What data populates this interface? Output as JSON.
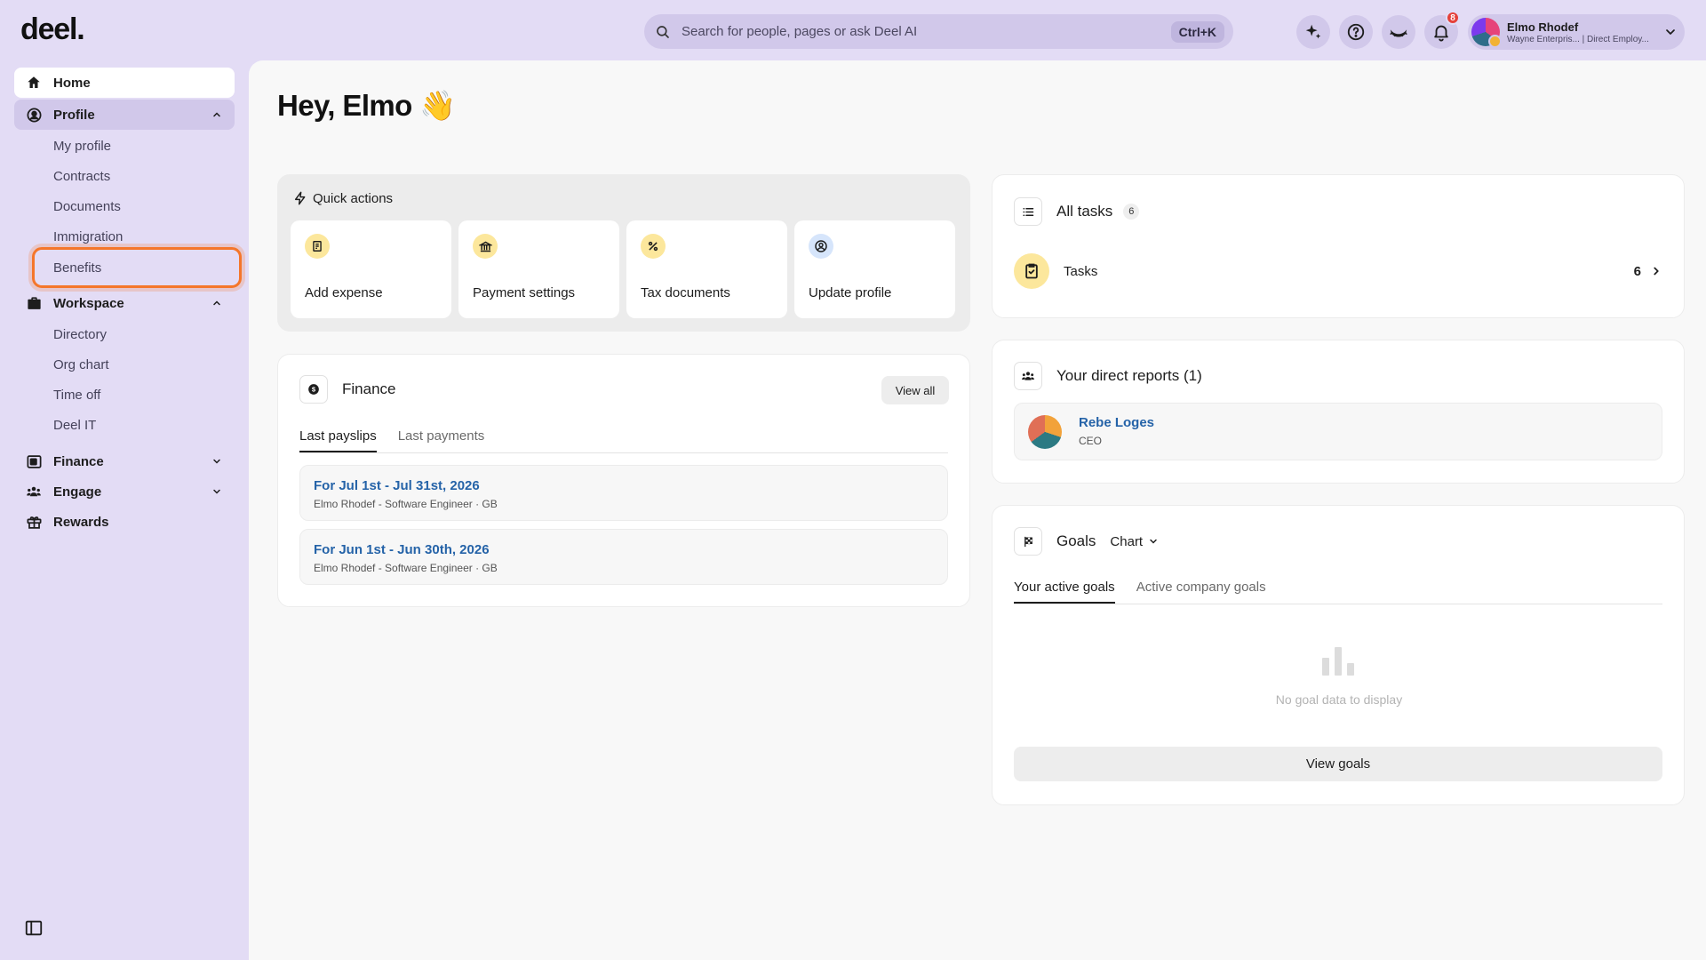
{
  "brand": {
    "logo_text": "deel."
  },
  "search": {
    "placeholder": "Search for people, pages or ask Deel AI",
    "shortcut": "Ctrl+K"
  },
  "topbar": {
    "notification_count": "8"
  },
  "user": {
    "name": "Elmo Rhodef",
    "subtitle": "Wayne Enterpris... | Direct Employ..."
  },
  "sidebar": {
    "home": "Home",
    "profile": "Profile",
    "profile_items": [
      "My profile",
      "Contracts",
      "Documents",
      "Immigration",
      "Benefits"
    ],
    "workspace": "Workspace",
    "workspace_items": [
      "Directory",
      "Org chart",
      "Time off",
      "Deel IT"
    ],
    "finance": "Finance",
    "engage": "Engage",
    "rewards": "Rewards"
  },
  "main": {
    "greeting": "Hey, Elmo 👋",
    "quick_actions": {
      "title": "Quick actions",
      "items": [
        "Add expense",
        "Payment settings",
        "Tax documents",
        "Update profile"
      ]
    },
    "finance": {
      "title": "Finance",
      "view_all": "View all",
      "tabs": [
        "Last payslips",
        "Last payments"
      ],
      "payslips": [
        {
          "title": "For Jul 1st - Jul 31st, 2026",
          "meta": "Elmo Rhodef - Software Engineer · GB"
        },
        {
          "title": "For Jun 1st - Jun 30th, 2026",
          "meta": "Elmo Rhodef - Software Engineer · GB"
        }
      ]
    },
    "tasks": {
      "title": "All tasks",
      "count": "6",
      "row_label": "Tasks",
      "row_count": "6"
    },
    "direct_reports": {
      "title": "Your direct reports (1)",
      "name": "Rebe Loges",
      "role": "CEO"
    },
    "goals": {
      "title": "Goals",
      "view_mode": "Chart",
      "tabs": [
        "Your active goals",
        "Active company goals"
      ],
      "empty_text": "No goal data to display",
      "view_goals": "View goals"
    }
  },
  "colors": {
    "accent_link": "#2563a8",
    "highlight": "#f5762a",
    "topbar_bg": "#e3dcf5"
  }
}
